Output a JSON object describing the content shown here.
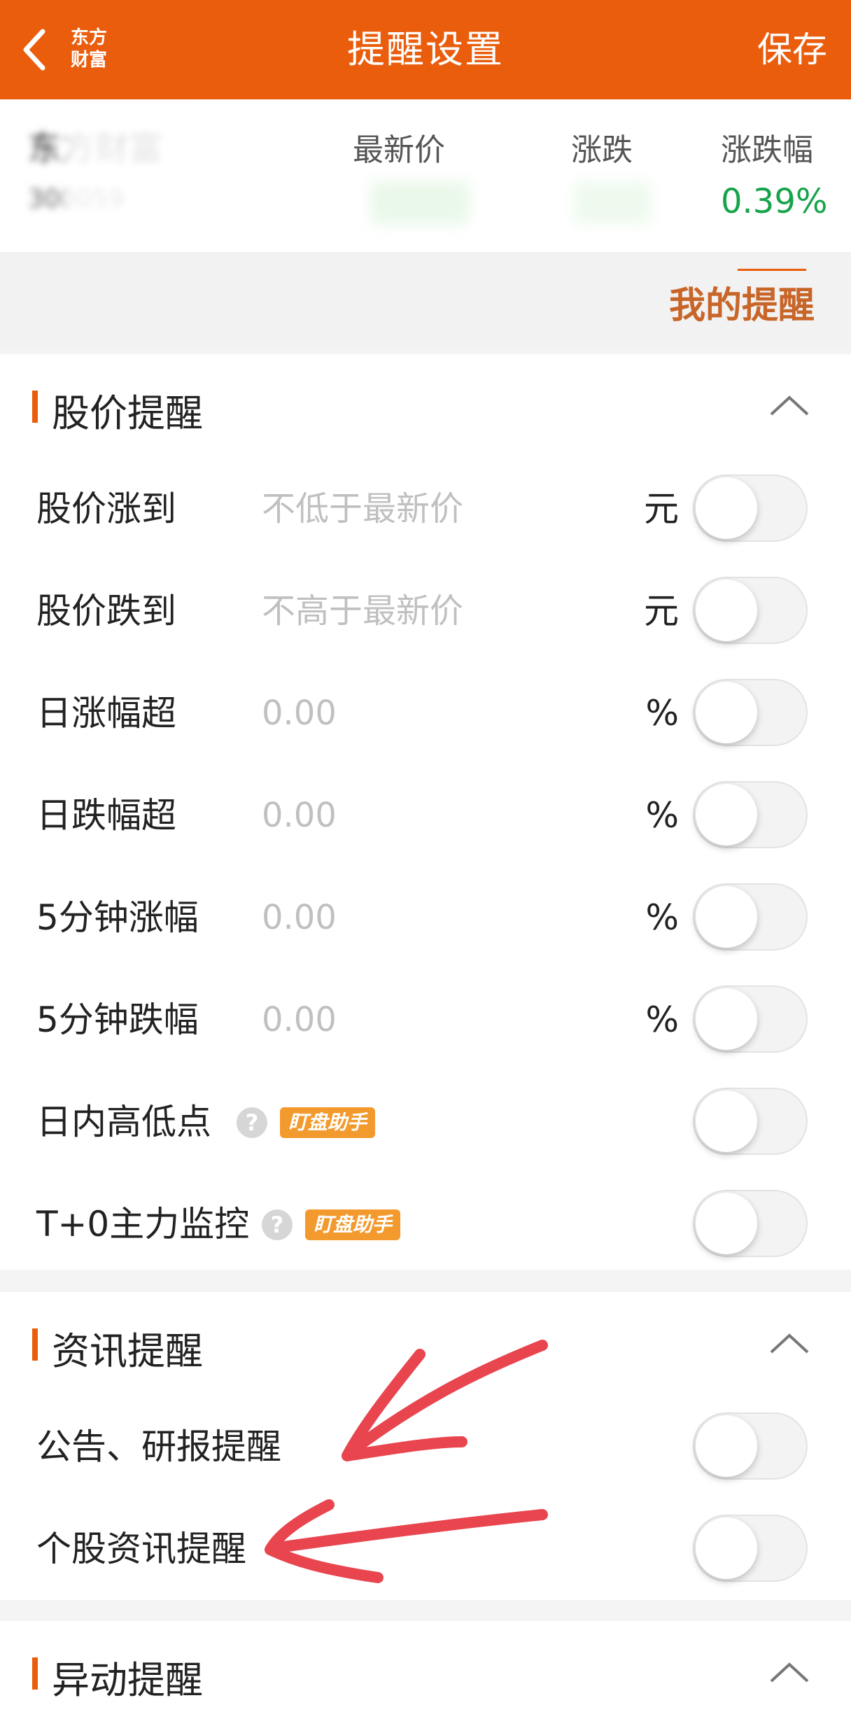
{
  "header": {
    "title": "提醒设置",
    "save_label": "保存",
    "logo_line1": "东方",
    "logo_line2": "财富",
    "background": "#e95d0c"
  },
  "stock": {
    "name": "东方财富",
    "code": "300059",
    "columns": [
      "最新价",
      "涨跌",
      "涨跌幅"
    ],
    "change_pct": "0.39%",
    "change_color": "#16a34a"
  },
  "my_reminders_label": "我的提醒",
  "sections": {
    "price": {
      "title": "股价提醒",
      "rows": [
        {
          "label": "股价涨到",
          "placeholder": "不低于最新价",
          "unit": "元"
        },
        {
          "label": "股价跌到",
          "placeholder": "不高于最新价",
          "unit": "元"
        },
        {
          "label": "日涨幅超",
          "placeholder": "0.00",
          "unit": "%"
        },
        {
          "label": "日跌幅超",
          "placeholder": "0.00",
          "unit": "%"
        },
        {
          "label": "5分钟涨幅",
          "placeholder": "0.00",
          "unit": "%"
        },
        {
          "label": "5分钟跌幅",
          "placeholder": "0.00",
          "unit": "%"
        },
        {
          "label": "日内高低点",
          "tag": "盯盘助手",
          "help": "?"
        },
        {
          "label": "T+0主力监控",
          "tag": "盯盘助手",
          "help": "?"
        }
      ]
    },
    "news": {
      "title": "资讯提醒",
      "rows": [
        {
          "label": "公告、研报提醒"
        },
        {
          "label": "个股资讯提醒"
        }
      ]
    },
    "movement": {
      "title": "异动提醒"
    }
  },
  "toggle_states": "all off",
  "accent_color": "#e95d0c",
  "annotation_arrow_color": "#e8454f"
}
